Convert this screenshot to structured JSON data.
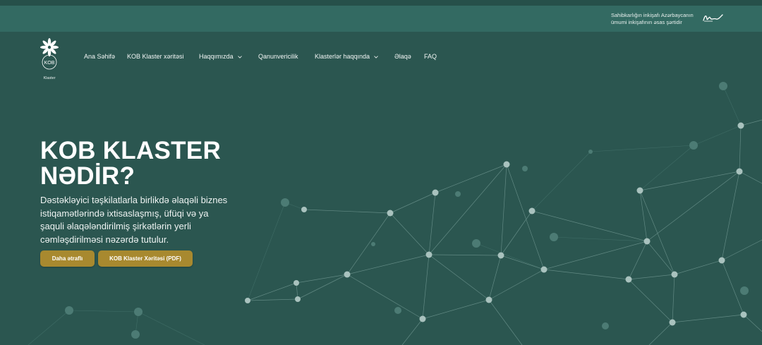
{
  "top_bar": {
    "slogan_line1": "Sahibkarlığın inkişafı Azərbaycanın",
    "slogan_line2": "ümumi inkişafının əsas şərtidir",
    "signature_icon": "signature-icon"
  },
  "logo": {
    "text": "KOB",
    "caption": "Klaster",
    "icon": "flower-icon"
  },
  "nav": [
    {
      "label": "Ana Səhifə",
      "dropdown": false
    },
    {
      "label": "KOB Klaster xəritəsi",
      "dropdown": false
    },
    {
      "label": "Haqqımızda",
      "dropdown": true
    },
    {
      "label": "Qanunvericilik",
      "dropdown": false
    },
    {
      "label": "Klasterlər haqqında",
      "dropdown": true
    },
    {
      "label": "Əlaqə",
      "dropdown": false
    },
    {
      "label": "FAQ",
      "dropdown": false
    }
  ],
  "hero": {
    "title_line1": "KOB KLASTER",
    "title_line2": "NƏDİR?",
    "description": "Dəstəkləyici təşkilatlarla birlikdə əlaqəli biznes istiqamətlərində ixtisaslaşmış, üfüqi və ya şaquli əlaqələndirilmiş şirkətlərin yerli cəmləşdirilməsi nəzərdə tutulur.",
    "buttons": [
      {
        "label": "Daha ətraflı"
      },
      {
        "label": "KOB Klaster Xəritəsi (PDF)"
      }
    ]
  },
  "colors": {
    "background": "#2b5650",
    "top_bar": "#336a62",
    "accent_button": "#a8892f",
    "network_node": "#a9c2be"
  }
}
